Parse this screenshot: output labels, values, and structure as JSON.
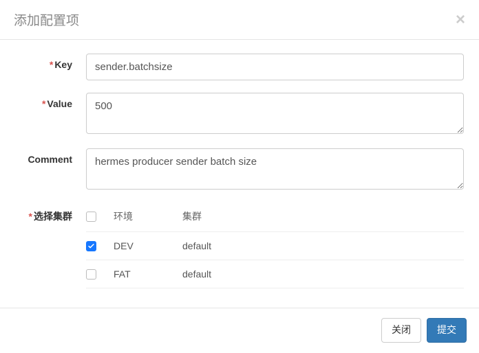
{
  "modal": {
    "title": "添加配置项",
    "close_aria": "Close"
  },
  "form": {
    "key": {
      "label": "Key",
      "value": "sender.batchsize"
    },
    "value": {
      "label": "Value",
      "value": "500"
    },
    "comment": {
      "label": "Comment",
      "value": "hermes producer sender batch size"
    },
    "cluster": {
      "label": "选择集群",
      "headers": {
        "env": "环境",
        "cluster": "集群"
      },
      "rows": [
        {
          "checked": true,
          "env": "DEV",
          "cluster": "default"
        },
        {
          "checked": false,
          "env": "FAT",
          "cluster": "default"
        }
      ]
    }
  },
  "footer": {
    "close_label": "关闭",
    "submit_label": "提交"
  }
}
